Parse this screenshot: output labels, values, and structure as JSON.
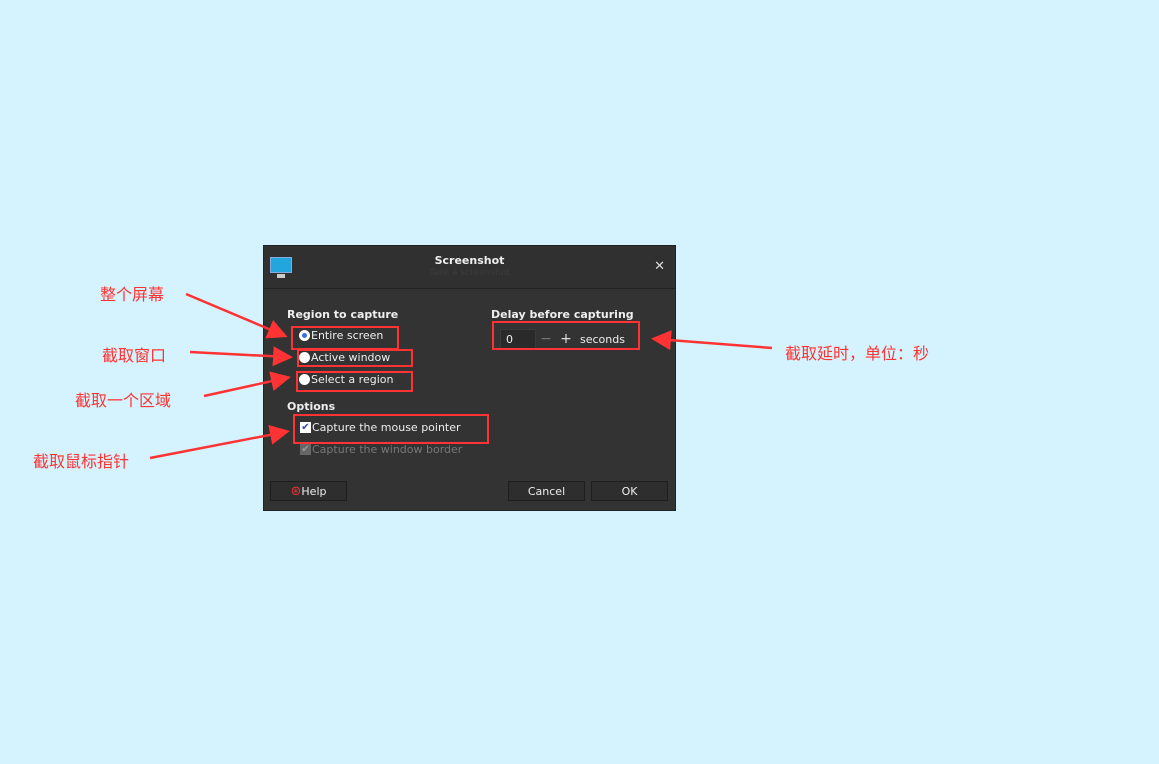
{
  "dialog": {
    "title": "Screenshot",
    "subtitle": "Take a screenshot",
    "close_icon": "close-icon",
    "region_heading": "Region to capture",
    "regions": [
      {
        "label": "Entire screen",
        "selected": true
      },
      {
        "label": "Active window",
        "selected": false
      },
      {
        "label": "Select a region",
        "selected": false
      }
    ],
    "delay_heading": "Delay before capturing",
    "delay_value": "0",
    "delay_unit": "seconds",
    "options_heading": "Options",
    "options": [
      {
        "label": "Capture the mouse pointer",
        "checked": true,
        "enabled": true
      },
      {
        "label": "Capture the window border",
        "checked": true,
        "enabled": false
      }
    ],
    "help_label": "Help",
    "cancel_label": "Cancel",
    "ok_label": "OK"
  },
  "annotations": {
    "entire_screen": "整个屏幕",
    "active_window": "截取窗口",
    "select_region": "截取一个区域",
    "mouse_pointer": "截取鼠标指针",
    "delay": "截取延时，单位：秒"
  },
  "colors": {
    "background": "#d4f3fe",
    "annotation": "#ff3333",
    "dialog": "#333333",
    "radio_selected": "#3a6fe0"
  }
}
